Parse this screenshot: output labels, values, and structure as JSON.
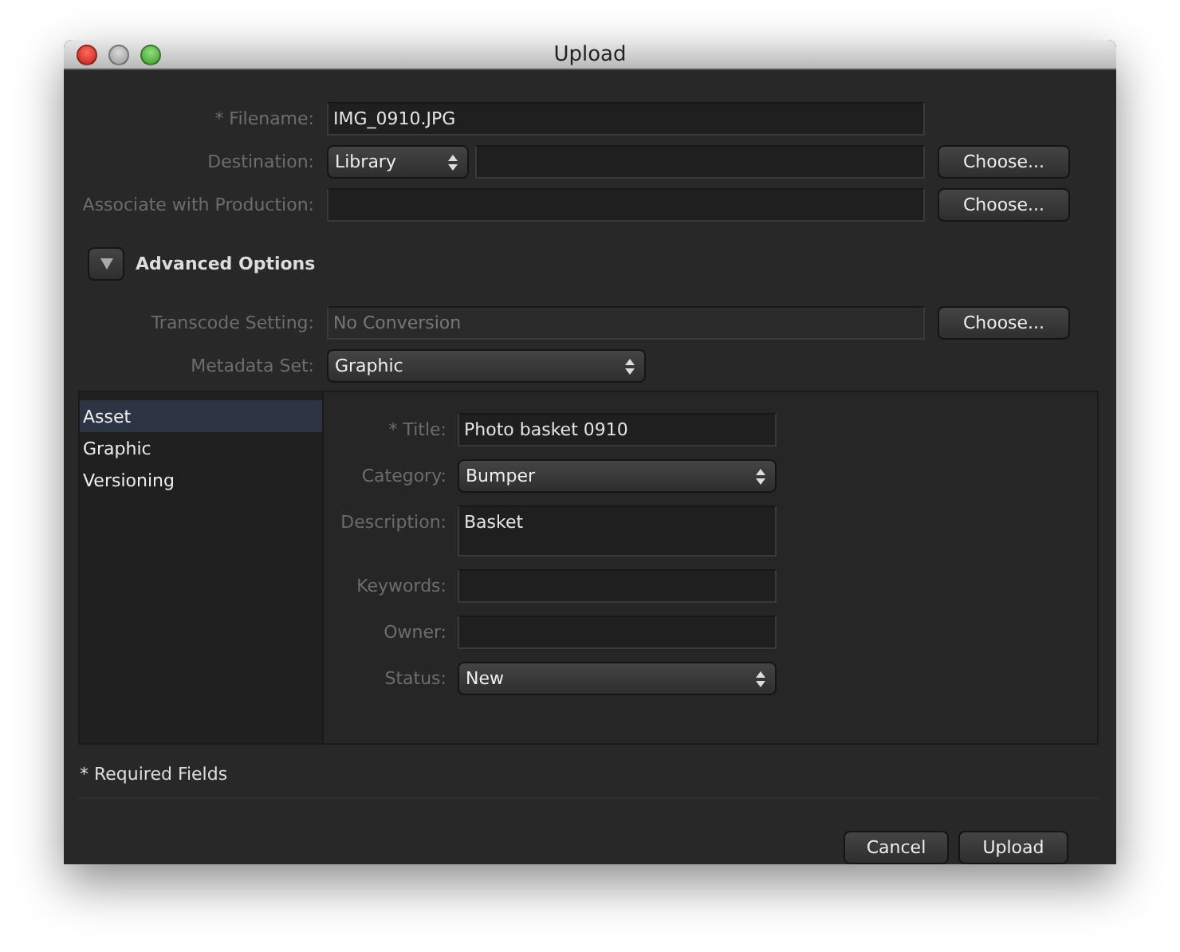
{
  "window": {
    "title": "Upload"
  },
  "fields": [
    {
      "kind": "text",
      "label": "* Filename:",
      "value": "IMG_0910.JPG"
    },
    {
      "kind": "select_choose",
      "label": "Destination:",
      "value": "Library",
      "button": "Choose..."
    },
    {
      "kind": "choose",
      "label": "Associate with Production:",
      "button": "Choose..."
    }
  ],
  "advanced": {
    "label": "Advanced Options",
    "expanded": true
  },
  "advanced_fields": [
    {
      "kind": "choose",
      "label": "Transcode Setting:",
      "value": "No Conversion",
      "disabled": true,
      "button": "Choose..."
    },
    {
      "kind": "select",
      "label": "Metadata Set:",
      "value": "Graphic"
    }
  ],
  "sections": [
    {
      "label": "Asset",
      "selected": true
    },
    {
      "label": "Graphic",
      "selected": false
    },
    {
      "label": "Versioning",
      "selected": false
    }
  ],
  "metadata_fields": [
    {
      "kind": "text",
      "label": "* Title:",
      "value": "Photo basket 0910"
    },
    {
      "kind": "select",
      "label": "Category:",
      "value": "Bumper"
    },
    {
      "kind": "textarea",
      "label": "Description:",
      "value": "Basket"
    },
    {
      "kind": "text",
      "label": "Keywords:"
    },
    {
      "kind": "text",
      "label": "Owner:"
    },
    {
      "kind": "select",
      "label": "Status:",
      "value": "New"
    }
  ],
  "footnote": "* Required Fields",
  "buttons": [
    "Cancel",
    "Upload"
  ]
}
